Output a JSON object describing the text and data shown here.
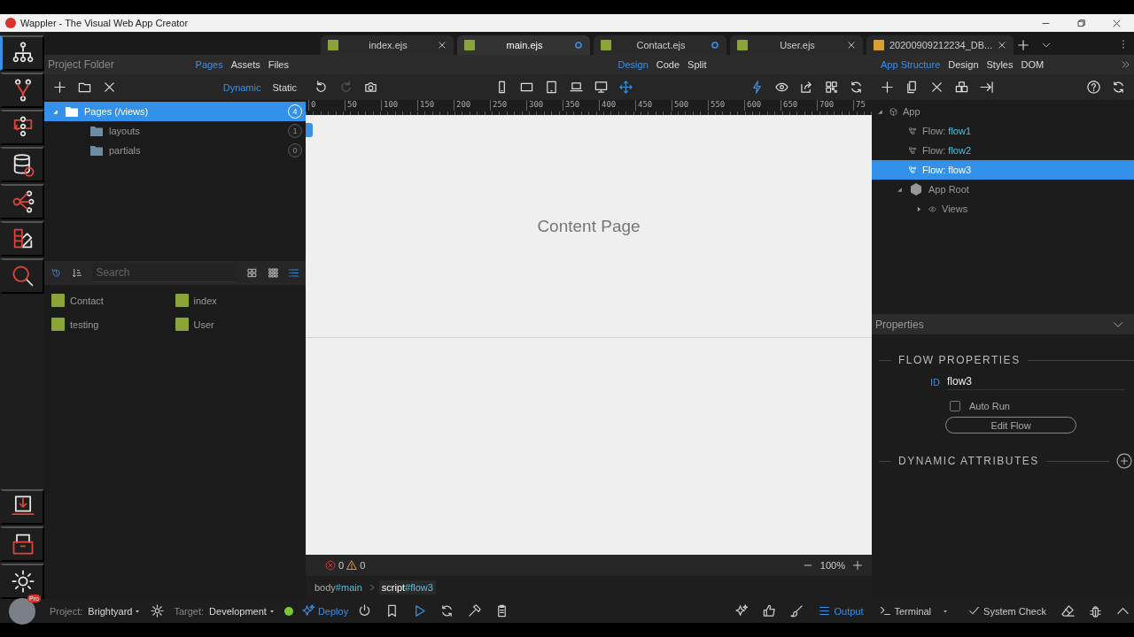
{
  "window": {
    "title": "Wappler - The Visual Web App Creator"
  },
  "rail": [
    {
      "kind": "app-structure",
      "selected": true
    },
    {
      "kind": "branch",
      "selected": false
    },
    {
      "kind": "server",
      "selected": false
    },
    {
      "kind": "database",
      "selected": false
    },
    {
      "kind": "network",
      "selected": false
    },
    {
      "kind": "palette",
      "selected": false
    },
    {
      "kind": "search",
      "selected": false
    }
  ],
  "rail_bottom": [
    {
      "kind": "document",
      "selected": false
    },
    {
      "kind": "export",
      "selected": false
    },
    {
      "kind": "settings",
      "selected": false
    }
  ],
  "avatar": {
    "badge": "Pro"
  },
  "tabs": [
    {
      "label": "index.ejs",
      "kind": "js",
      "selected": false,
      "modified": false
    },
    {
      "label": "main.ejs",
      "kind": "js",
      "selected": true,
      "modified": true
    },
    {
      "label": "Contact.ejs",
      "kind": "js",
      "selected": false,
      "modified": true
    },
    {
      "label": "User.ejs",
      "kind": "js",
      "selected": false,
      "modified": false
    },
    {
      "label": "20200909212234_DB...",
      "kind": "db",
      "selected": false,
      "modified": false
    }
  ],
  "project_panel": {
    "title": "Project Folder",
    "tabs": [
      {
        "label": "Pages",
        "selected": true
      },
      {
        "label": "Assets",
        "selected": false
      },
      {
        "label": "Files",
        "selected": false
      }
    ],
    "modes": [
      {
        "label": "Dynamic",
        "selected": true
      },
      {
        "label": "Static",
        "selected": false
      }
    ],
    "tree": [
      {
        "label": "Pages (/views)",
        "count": "4",
        "expanded": true,
        "selected": true,
        "children": [
          {
            "label": "layouts",
            "count": "1",
            "selected": false
          },
          {
            "label": "partials",
            "count": "0",
            "selected": false
          }
        ]
      }
    ],
    "search": {
      "placeholder": "Search"
    },
    "views": [
      {
        "kind": "large",
        "selected": false
      },
      {
        "kind": "small",
        "selected": false
      },
      {
        "kind": "list",
        "selected": true
      }
    ],
    "files": [
      {
        "label": "Contact"
      },
      {
        "label": "index"
      },
      {
        "label": "testing"
      },
      {
        "label": "User"
      }
    ]
  },
  "editor": {
    "modes": [
      {
        "label": "Design",
        "selected": true
      },
      {
        "label": "Code",
        "selected": false
      },
      {
        "label": "Split",
        "selected": false
      }
    ],
    "toolbar": [
      {
        "kind": "undo",
        "active": false,
        "disabled": false
      },
      {
        "kind": "redo",
        "active": false,
        "disabled": true
      },
      {
        "kind": "camera",
        "active": false,
        "disabled": false
      },
      {
        "kind": "phone",
        "active": false,
        "disabled": false
      },
      {
        "kind": "tablet",
        "active": false,
        "disabled": false
      },
      {
        "kind": "tabletp",
        "active": false,
        "disabled": false
      },
      {
        "kind": "laptop",
        "active": false,
        "disabled": false
      },
      {
        "kind": "desktop",
        "active": false,
        "disabled": false
      },
      {
        "kind": "move",
        "active": true,
        "disabled": false
      },
      {
        "kind": "bolt",
        "active": true,
        "disabled": false
      },
      {
        "kind": "eye",
        "active": false,
        "disabled": false
      },
      {
        "kind": "share",
        "active": false,
        "disabled": false
      },
      {
        "kind": "qr",
        "active": false,
        "disabled": false
      },
      {
        "kind": "refresh",
        "active": false,
        "disabled": false
      }
    ],
    "ruler": [
      "0",
      "50",
      "100",
      "150",
      "200",
      "250",
      "300",
      "350",
      "400",
      "450",
      "500",
      "550",
      "600",
      "650",
      "700",
      "75"
    ],
    "canvas": {
      "heading": "Content Page"
    },
    "errors": "0",
    "warnings": "0",
    "zoom": "100%",
    "breadcrumb": [
      {
        "tag": "body",
        "id": "#main",
        "selected": false
      },
      {
        "tag": "script",
        "id": "#flow3",
        "selected": true
      }
    ]
  },
  "structure_panel": {
    "tabs": [
      {
        "label": "App Structure",
        "selected": true
      },
      {
        "label": "Design",
        "selected": false
      },
      {
        "label": "Styles",
        "selected": false
      },
      {
        "label": "DOM",
        "selected": false
      }
    ],
    "tree": [
      {
        "kind": "app",
        "label": "App",
        "expanded": true,
        "selected": false,
        "children": [
          {
            "kind": "flow",
            "label": "Flow:",
            "name": "flow1",
            "selected": false
          },
          {
            "kind": "flow",
            "label": "Flow:",
            "name": "flow2",
            "selected": false
          },
          {
            "kind": "flow",
            "label": "Flow:",
            "name": "flow3",
            "selected": true
          },
          {
            "kind": "root",
            "label": "App Root",
            "expanded": true,
            "selected": false,
            "children": [
              {
                "kind": "views",
                "label": "Views",
                "expanded": false,
                "selected": false
              }
            ]
          }
        ]
      }
    ]
  },
  "properties": {
    "title": "Properties",
    "section": "FLOW PROPERTIES",
    "id_label": "ID",
    "id_value": "flow3",
    "auto_run": {
      "label": "Auto Run",
      "checked": false
    },
    "edit_button": "Edit Flow",
    "dynamic_section": "DYNAMIC ATTRIBUTES"
  },
  "bottom_bar": {
    "project_label": "Project:",
    "project": "Brightyard",
    "target_label": "Target:",
    "target": "Development",
    "connected": true,
    "deploy": "Deploy",
    "panels": [
      {
        "kind": "output",
        "label": "Output",
        "selected": true
      },
      {
        "kind": "terminal",
        "label": "Terminal",
        "selected": false
      }
    ],
    "system_check": "System Check"
  }
}
